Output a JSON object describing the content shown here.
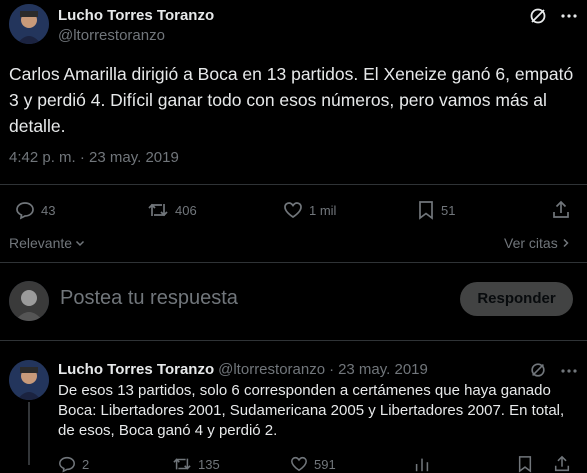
{
  "main_tweet": {
    "author_name": "Lucho Torres Toranzo",
    "author_handle": "@ltorrestoranzo",
    "text": "Carlos Amarilla dirigió a Boca en 13 partidos. El Xeneize ganó 6, empató 3 y perdió 4. Difícil ganar todo con esos números, pero vamos más al detalle.",
    "timestamp": "4:42 p. m. · 23 may. 2019",
    "replies": "43",
    "reposts": "406",
    "likes": "1 mil",
    "bookmarks": "51"
  },
  "sort": {
    "label": "Relevante",
    "quotes_link": "Ver citas"
  },
  "composer": {
    "placeholder": "Postea tu respuesta",
    "button_label": "Responder"
  },
  "reply_tweet": {
    "author_name": "Lucho Torres Toranzo",
    "author_handle": "@ltorrestoranzo",
    "separator": "·",
    "date": "23 may. 2019",
    "text": "De esos 13 partidos, solo 6 corresponden a certámenes que haya ganado Boca: Libertadores 2001, Sudamericana 2005 y Libertadores 2007. En total, de esos, Boca ganó 4 y perdió 2.",
    "replies": "2",
    "reposts": "135",
    "likes": "591"
  },
  "icons": [
    "grok-icon",
    "reply-icon",
    "repost-icon",
    "like-icon",
    "bookmark-icon",
    "share-icon",
    "chevron-down-icon",
    "chevron-right-icon"
  ]
}
